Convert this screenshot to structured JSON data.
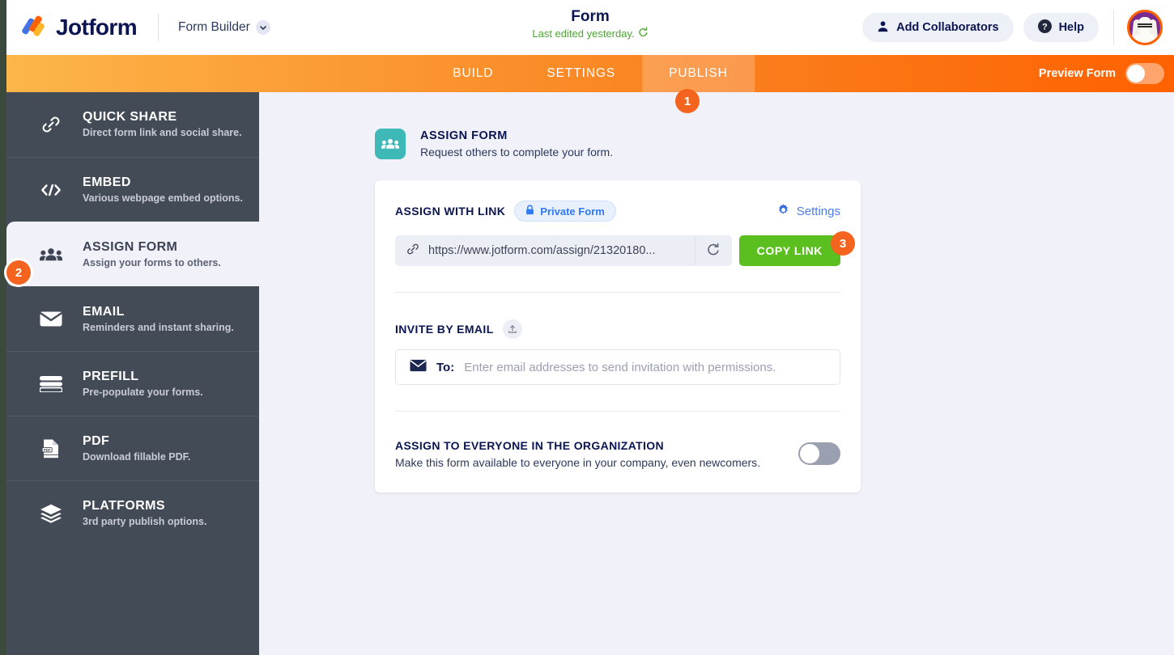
{
  "brand": {
    "name": "Jotform",
    "product_menu": "Form Builder"
  },
  "header": {
    "title": "Form",
    "subtitle": "Last edited yesterday.",
    "add_collaborators": "Add Collaborators",
    "help": "Help"
  },
  "navbar": {
    "tabs": [
      {
        "label": "BUILD",
        "active": false
      },
      {
        "label": "SETTINGS",
        "active": false
      },
      {
        "label": "PUBLISH",
        "active": true
      }
    ],
    "preview_label": "Preview Form",
    "preview_on": false
  },
  "sidebar": {
    "items": [
      {
        "title": "QUICK SHARE",
        "desc": "Direct form link and social share.",
        "icon": "link-icon",
        "active": false
      },
      {
        "title": "EMBED",
        "desc": "Various webpage embed options.",
        "icon": "code-icon",
        "active": false
      },
      {
        "title": "ASSIGN FORM",
        "desc": "Assign your forms to others.",
        "icon": "people-icon",
        "active": true
      },
      {
        "title": "EMAIL",
        "desc": "Reminders and instant sharing.",
        "icon": "envelope-icon",
        "active": false
      },
      {
        "title": "PREFILL",
        "desc": "Pre-populate your forms.",
        "icon": "prefill-icon",
        "active": false
      },
      {
        "title": "PDF",
        "desc": "Download fillable PDF.",
        "icon": "pdf-icon",
        "active": false
      },
      {
        "title": "PLATFORMS",
        "desc": "3rd party publish options.",
        "icon": "layers-icon",
        "active": false
      }
    ]
  },
  "main": {
    "section": {
      "title": "ASSIGN FORM",
      "subtitle": "Request others to complete your form.",
      "icon": "people-icon"
    },
    "assign_with_link": {
      "label": "ASSIGN WITH LINK",
      "privacy_badge": "Private Form",
      "settings_label": "Settings",
      "url": "https://www.jotform.com/assign/21320180...",
      "copy_label": "COPY LINK"
    },
    "invite_by_email": {
      "label": "INVITE BY EMAIL",
      "to_label": "To:",
      "placeholder": "Enter email addresses to send invitation with permissions."
    },
    "assign_everyone": {
      "title": "ASSIGN TO EVERYONE IN THE ORGANIZATION",
      "desc": "Make this form available to everyone in your company, even newcomers.",
      "enabled": false
    }
  },
  "callouts": [
    {
      "number": "1",
      "target": "publish-tab"
    },
    {
      "number": "2",
      "target": "sidebar-item-assign-form"
    },
    {
      "number": "3",
      "target": "copy-link-button"
    }
  ],
  "colors": {
    "brand_orange": "#ff6100",
    "nav_gradient_start": "#fcb64a",
    "nav_gradient_end": "#ff6100",
    "sidebar_bg": "#434b57",
    "page_bg": "#f1f1f9",
    "copy_green": "#5cbf20",
    "callout_orange": "#f4641e",
    "accent_teal": "#3fb8b8",
    "link_blue": "#4b7bec",
    "edited_green": "#4aa832"
  }
}
